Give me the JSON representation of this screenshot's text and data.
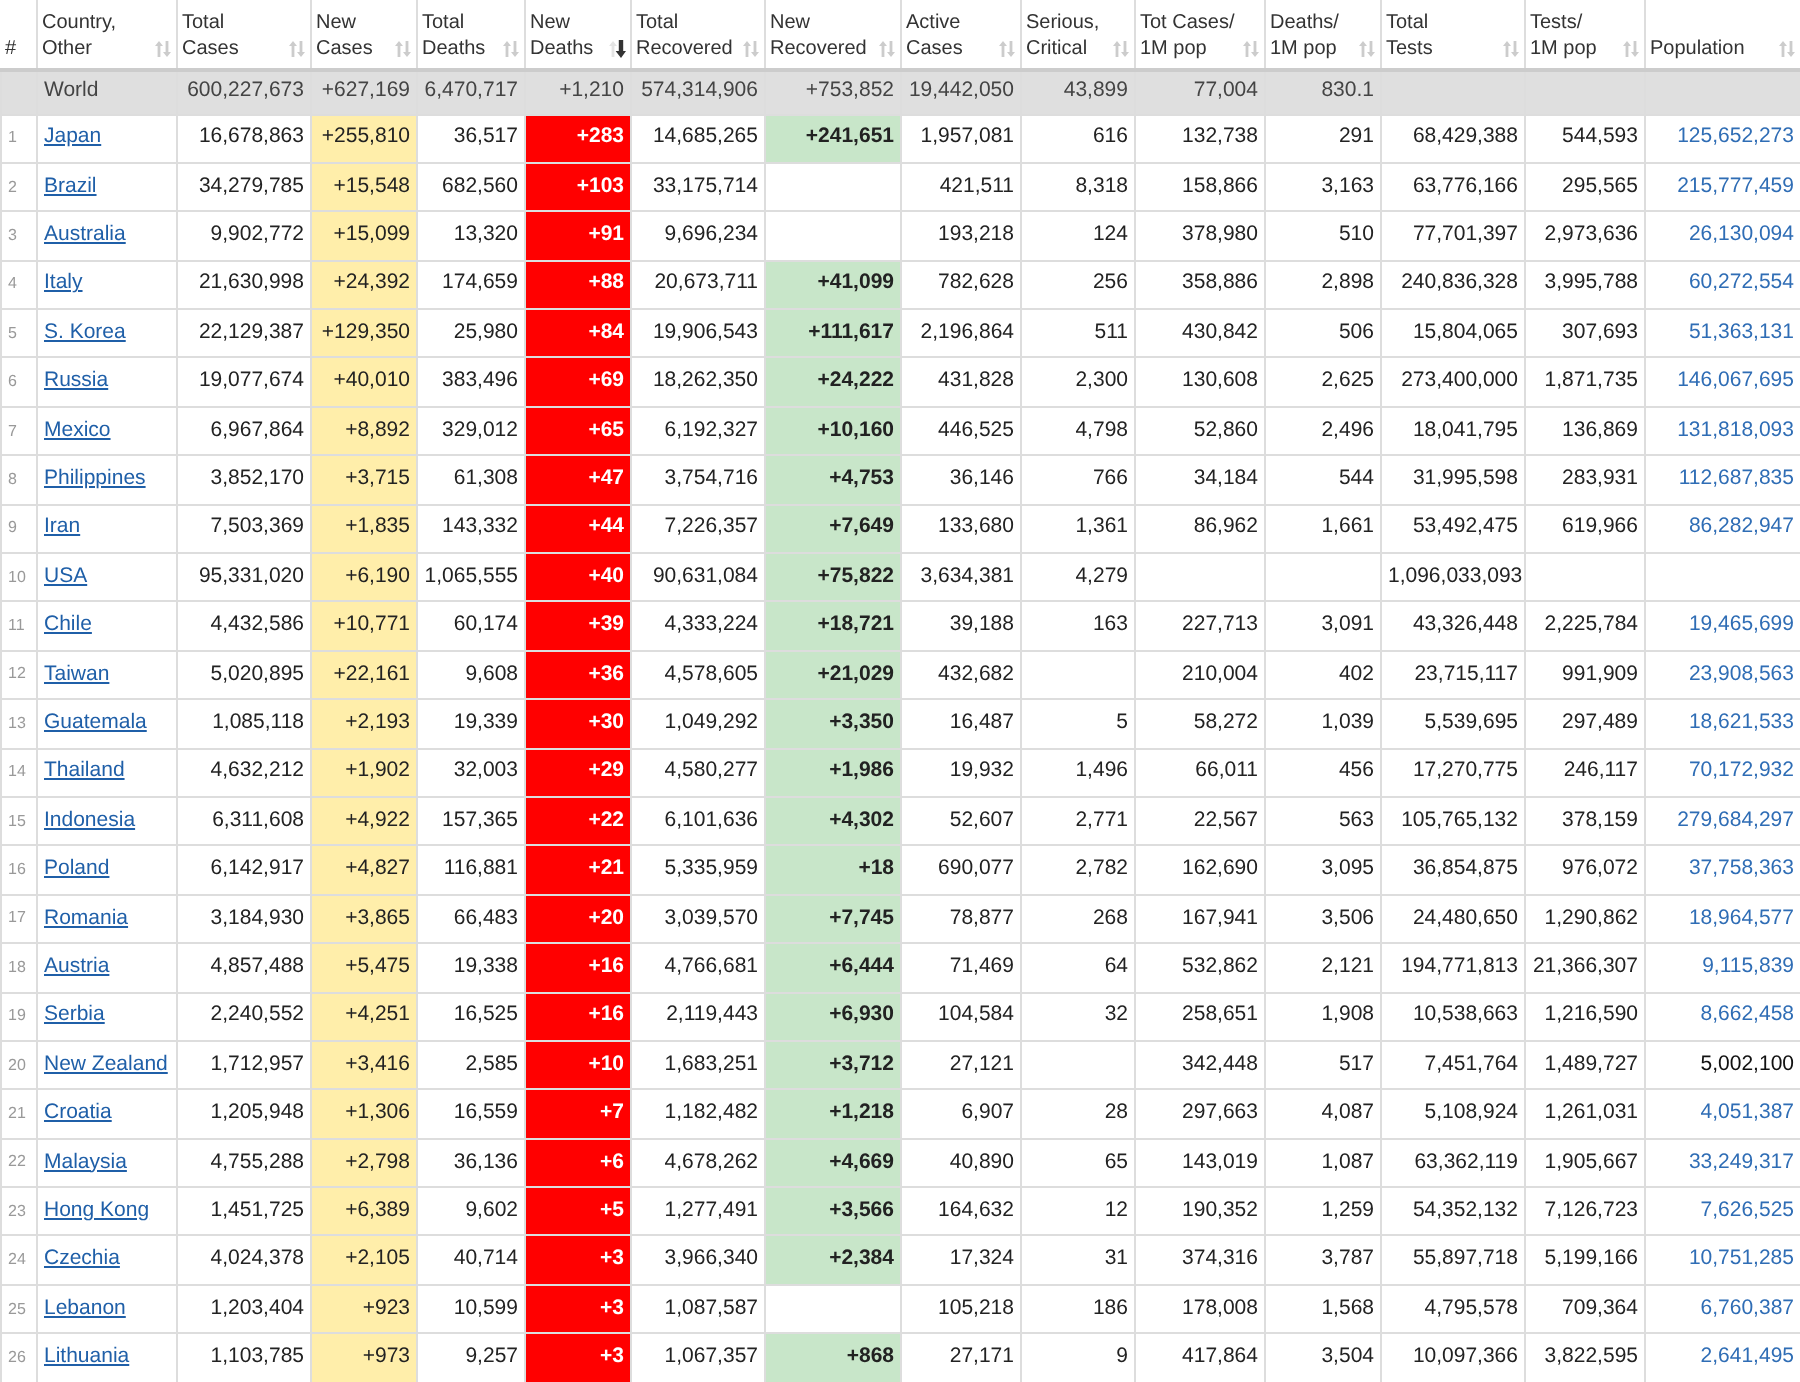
{
  "table": {
    "columns": [
      {
        "lines": [
          "#"
        ],
        "kind": "index"
      },
      {
        "lines": [
          "Country,",
          "Other"
        ],
        "kind": "country",
        "sorted": false
      },
      {
        "lines": [
          "Total",
          "Cases"
        ],
        "kind": "number",
        "sorted": false
      },
      {
        "lines": [
          "New",
          "Cases"
        ],
        "kind": "new_cases",
        "sorted": false
      },
      {
        "lines": [
          "Total",
          "Deaths"
        ],
        "kind": "number",
        "sorted": false
      },
      {
        "lines": [
          "New",
          "Deaths"
        ],
        "kind": "new_deaths",
        "sorted": true
      },
      {
        "lines": [
          "Total",
          "Recovered"
        ],
        "kind": "number",
        "sorted": false
      },
      {
        "lines": [
          "New",
          "Recovered"
        ],
        "kind": "new_recovered",
        "sorted": false
      },
      {
        "lines": [
          "Active",
          "Cases"
        ],
        "kind": "number",
        "sorted": false
      },
      {
        "lines": [
          "Serious,",
          "Critical"
        ],
        "kind": "number",
        "sorted": false
      },
      {
        "lines": [
          "Tot Cases/",
          "1M pop"
        ],
        "kind": "number",
        "sorted": false
      },
      {
        "lines": [
          "Deaths/",
          "1M pop"
        ],
        "kind": "number",
        "sorted": false
      },
      {
        "lines": [
          "Total",
          "Tests"
        ],
        "kind": "number",
        "sorted": false
      },
      {
        "lines": [
          "Tests/",
          "1M pop"
        ],
        "kind": "number",
        "sorted": false
      },
      {
        "lines": [
          "Population"
        ],
        "kind": "population",
        "sorted": false
      }
    ],
    "rows": [
      {
        "kind": "world",
        "cells": [
          null,
          "World",
          "600,227,673",
          "+627,169",
          "6,470,717",
          "+1,210",
          "574,314,906",
          "+753,852",
          "19,442,050",
          "43,899",
          "77,004",
          "830.1",
          null,
          null,
          null
        ]
      },
      {
        "kind": "country",
        "population_linked": true,
        "cells": [
          "1",
          "Japan",
          "16,678,863",
          "+255,810",
          "36,517",
          "+283",
          "14,685,265",
          "+241,651",
          "1,957,081",
          "616",
          "132,738",
          "291",
          "68,429,388",
          "544,593",
          "125,652,273"
        ]
      },
      {
        "kind": "country",
        "population_linked": true,
        "cells": [
          "2",
          "Brazil",
          "34,279,785",
          "+15,548",
          "682,560",
          "+103",
          "33,175,714",
          null,
          "421,511",
          "8,318",
          "158,866",
          "3,163",
          "63,776,166",
          "295,565",
          "215,777,459"
        ]
      },
      {
        "kind": "country",
        "population_linked": true,
        "cells": [
          "3",
          "Australia",
          "9,902,772",
          "+15,099",
          "13,320",
          "+91",
          "9,696,234",
          null,
          "193,218",
          "124",
          "378,980",
          "510",
          "77,701,397",
          "2,973,636",
          "26,130,094"
        ]
      },
      {
        "kind": "country",
        "population_linked": true,
        "cells": [
          "4",
          "Italy",
          "21,630,998",
          "+24,392",
          "174,659",
          "+88",
          "20,673,711",
          "+41,099",
          "782,628",
          "256",
          "358,886",
          "2,898",
          "240,836,328",
          "3,995,788",
          "60,272,554"
        ]
      },
      {
        "kind": "country",
        "population_linked": true,
        "cells": [
          "5",
          "S. Korea",
          "22,129,387",
          "+129,350",
          "25,980",
          "+84",
          "19,906,543",
          "+111,617",
          "2,196,864",
          "511",
          "430,842",
          "506",
          "15,804,065",
          "307,693",
          "51,363,131"
        ]
      },
      {
        "kind": "country",
        "population_linked": true,
        "cells": [
          "6",
          "Russia",
          "19,077,674",
          "+40,010",
          "383,496",
          "+69",
          "18,262,350",
          "+24,222",
          "431,828",
          "2,300",
          "130,608",
          "2,625",
          "273,400,000",
          "1,871,735",
          "146,067,695"
        ]
      },
      {
        "kind": "country",
        "population_linked": true,
        "cells": [
          "7",
          "Mexico",
          "6,967,864",
          "+8,892",
          "329,012",
          "+65",
          "6,192,327",
          "+10,160",
          "446,525",
          "4,798",
          "52,860",
          "2,496",
          "18,041,795",
          "136,869",
          "131,818,093"
        ]
      },
      {
        "kind": "country",
        "population_linked": true,
        "cells": [
          "8",
          "Philippines",
          "3,852,170",
          "+3,715",
          "61,308",
          "+47",
          "3,754,716",
          "+4,753",
          "36,146",
          "766",
          "34,184",
          "544",
          "31,995,598",
          "283,931",
          "112,687,835"
        ]
      },
      {
        "kind": "country",
        "population_linked": true,
        "cells": [
          "9",
          "Iran",
          "7,503,369",
          "+1,835",
          "143,332",
          "+44",
          "7,226,357",
          "+7,649",
          "133,680",
          "1,361",
          "86,962",
          "1,661",
          "53,492,475",
          "619,966",
          "86,282,947"
        ]
      },
      {
        "kind": "country",
        "cells": [
          "10",
          "USA",
          "95,331,020",
          "+6,190",
          "1,065,555",
          "+40",
          "90,631,084",
          "+75,822",
          "3,634,381",
          "4,279",
          null,
          null,
          "1,096,033,093",
          null,
          null
        ]
      },
      {
        "kind": "country",
        "population_linked": true,
        "cells": [
          "11",
          "Chile",
          "4,432,586",
          "+10,771",
          "60,174",
          "+39",
          "4,333,224",
          "+18,721",
          "39,188",
          "163",
          "227,713",
          "3,091",
          "43,326,448",
          "2,225,784",
          "19,465,699"
        ]
      },
      {
        "kind": "country",
        "population_linked": true,
        "cells": [
          "12",
          "Taiwan",
          "5,020,895",
          "+22,161",
          "9,608",
          "+36",
          "4,578,605",
          "+21,029",
          "432,682",
          null,
          "210,004",
          "402",
          "23,715,117",
          "991,909",
          "23,908,563"
        ]
      },
      {
        "kind": "country",
        "population_linked": true,
        "cells": [
          "13",
          "Guatemala",
          "1,085,118",
          "+2,193",
          "19,339",
          "+30",
          "1,049,292",
          "+3,350",
          "16,487",
          "5",
          "58,272",
          "1,039",
          "5,539,695",
          "297,489",
          "18,621,533"
        ]
      },
      {
        "kind": "country",
        "population_linked": true,
        "cells": [
          "14",
          "Thailand",
          "4,632,212",
          "+1,902",
          "32,003",
          "+29",
          "4,580,277",
          "+1,986",
          "19,932",
          "1,496",
          "66,011",
          "456",
          "17,270,775",
          "246,117",
          "70,172,932"
        ]
      },
      {
        "kind": "country",
        "population_linked": true,
        "cells": [
          "15",
          "Indonesia",
          "6,311,608",
          "+4,922",
          "157,365",
          "+22",
          "6,101,636",
          "+4,302",
          "52,607",
          "2,771",
          "22,567",
          "563",
          "105,765,132",
          "378,159",
          "279,684,297"
        ]
      },
      {
        "kind": "country",
        "population_linked": true,
        "cells": [
          "16",
          "Poland",
          "6,142,917",
          "+4,827",
          "116,881",
          "+21",
          "5,335,959",
          "+18",
          "690,077",
          "2,782",
          "162,690",
          "3,095",
          "36,854,875",
          "976,072",
          "37,758,363"
        ]
      },
      {
        "kind": "country",
        "population_linked": true,
        "cells": [
          "17",
          "Romania",
          "3,184,930",
          "+3,865",
          "66,483",
          "+20",
          "3,039,570",
          "+7,745",
          "78,877",
          "268",
          "167,941",
          "3,506",
          "24,480,650",
          "1,290,862",
          "18,964,577"
        ]
      },
      {
        "kind": "country",
        "population_linked": true,
        "cells": [
          "18",
          "Austria",
          "4,857,488",
          "+5,475",
          "19,338",
          "+16",
          "4,766,681",
          "+6,444",
          "71,469",
          "64",
          "532,862",
          "2,121",
          "194,771,813",
          "21,366,307",
          "9,115,839"
        ]
      },
      {
        "kind": "country",
        "population_linked": true,
        "cells": [
          "19",
          "Serbia",
          "2,240,552",
          "+4,251",
          "16,525",
          "+16",
          "2,119,443",
          "+6,930",
          "104,584",
          "32",
          "258,651",
          "1,908",
          "10,538,663",
          "1,216,590",
          "8,662,458"
        ]
      },
      {
        "kind": "country",
        "population_linked": false,
        "cells": [
          "20",
          "New Zealand",
          "1,712,957",
          "+3,416",
          "2,585",
          "+10",
          "1,683,251",
          "+3,712",
          "27,121",
          null,
          "342,448",
          "517",
          "7,451,764",
          "1,489,727",
          "5,002,100"
        ]
      },
      {
        "kind": "country",
        "population_linked": true,
        "cells": [
          "21",
          "Croatia",
          "1,205,948",
          "+1,306",
          "16,559",
          "+7",
          "1,182,482",
          "+1,218",
          "6,907",
          "28",
          "297,663",
          "4,087",
          "5,108,924",
          "1,261,031",
          "4,051,387"
        ]
      },
      {
        "kind": "country",
        "population_linked": true,
        "cells": [
          "22",
          "Malaysia",
          "4,755,288",
          "+2,798",
          "36,136",
          "+6",
          "4,678,262",
          "+4,669",
          "40,890",
          "65",
          "143,019",
          "1,087",
          "63,362,119",
          "1,905,667",
          "33,249,317"
        ]
      },
      {
        "kind": "country",
        "population_linked": true,
        "cells": [
          "23",
          "Hong Kong",
          "1,451,725",
          "+6,389",
          "9,602",
          "+5",
          "1,277,491",
          "+3,566",
          "164,632",
          "12",
          "190,352",
          "1,259",
          "54,352,132",
          "7,126,723",
          "7,626,525"
        ]
      },
      {
        "kind": "country",
        "population_linked": true,
        "cells": [
          "24",
          "Czechia",
          "4,024,378",
          "+2,105",
          "40,714",
          "+3",
          "3,966,340",
          "+2,384",
          "17,324",
          "31",
          "374,316",
          "3,787",
          "55,897,718",
          "5,199,166",
          "10,751,285"
        ]
      },
      {
        "kind": "country",
        "population_linked": true,
        "cells": [
          "25",
          "Lebanon",
          "1,203,404",
          "+923",
          "10,599",
          "+3",
          "1,087,587",
          null,
          "105,218",
          "186",
          "178,008",
          "1,568",
          "4,795,578",
          "709,364",
          "6,760,387"
        ]
      },
      {
        "kind": "country",
        "population_linked": true,
        "cells": [
          "26",
          "Lithuania",
          "1,103,785",
          "+973",
          "9,257",
          "+3",
          "1,067,357",
          "+868",
          "27,171",
          "9",
          "417,864",
          "3,504",
          "10,097,366",
          "3,822,595",
          "2,641,495"
        ]
      }
    ]
  }
}
